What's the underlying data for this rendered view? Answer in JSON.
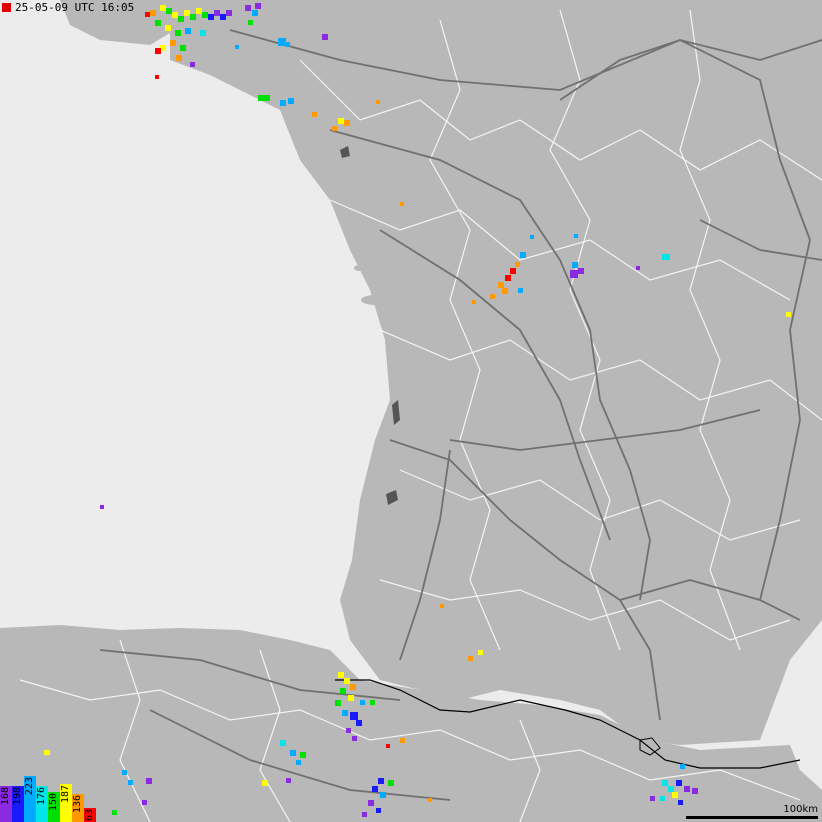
{
  "timestamp": "25-05-09 UTC 16:05",
  "scale": {
    "label": "100km"
  },
  "legend": {
    "labels": [
      "168",
      "198",
      "223",
      "176",
      "150",
      "187",
      "136",
      "63"
    ],
    "colors": [
      "#8a2be2",
      "#1a1aff",
      "#00aaff",
      "#00e5e5",
      "#00e000",
      "#ffff00",
      "#ff9900",
      "#ff0000"
    ]
  },
  "colors": {
    "sea": "#ececec",
    "land": "#b8b8b8",
    "roads": "#707070",
    "borders": "#ffffff",
    "national_border": "#000000"
  },
  "strikes": {
    "groups": [
      {
        "name": "brittany-north",
        "colors": [
          "#ffff00",
          "#00e000",
          "#ff9900",
          "#1a1aff",
          "#8a2be2",
          "#00aaff",
          "#ff0000",
          "#00e5e5"
        ]
      },
      {
        "name": "loire-coast",
        "colors": [
          "#00e000",
          "#00aaff",
          "#ff9900",
          "#ffff00"
        ]
      },
      {
        "name": "central-west",
        "colors": [
          "#ff0000",
          "#ff9900",
          "#00aaff",
          "#8a2be2",
          "#00e5e5"
        ]
      },
      {
        "name": "pyrenees-west",
        "colors": [
          "#ffff00",
          "#00e000",
          "#00aaff",
          "#1a1aff",
          "#8a2be2",
          "#ff9900",
          "#00e5e5"
        ]
      },
      {
        "name": "spain-south",
        "colors": [
          "#1a1aff",
          "#00e000",
          "#8a2be2",
          "#00aaff",
          "#ffff00"
        ]
      },
      {
        "name": "catalonia",
        "colors": [
          "#00e5e5",
          "#1a1aff",
          "#ffff00",
          "#8a2be2"
        ]
      }
    ]
  }
}
